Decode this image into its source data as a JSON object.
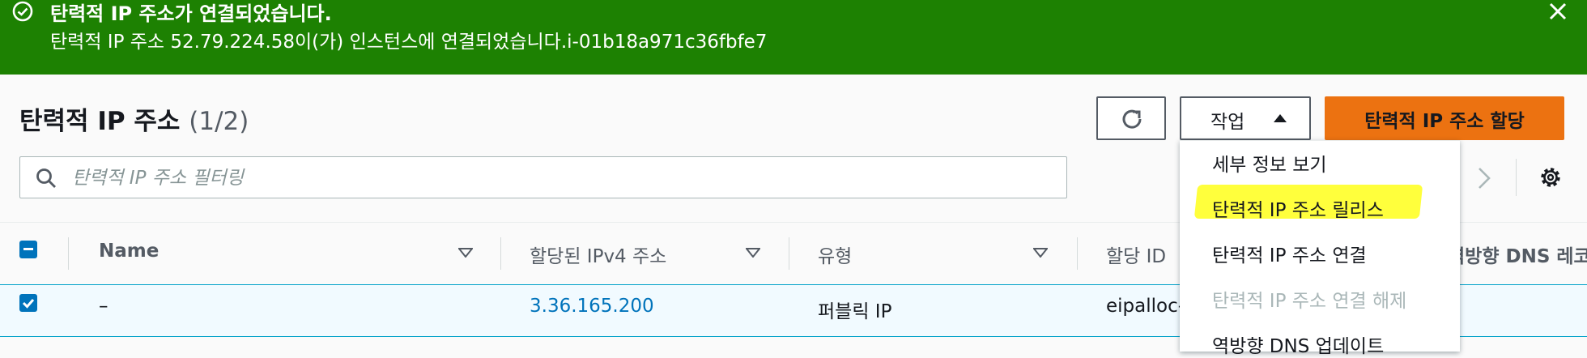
{
  "banner": {
    "title": "탄력적 IP 주소가 연결되었습니다.",
    "message": "탄력적 IP 주소 52.79.224.58이(가) 인스턴스에 연결되었습니다.i-01b18a971c36fbfe7",
    "color": "#1d8102"
  },
  "header": {
    "title": "탄력적 IP 주소",
    "count": "(1/2)",
    "actions_label": "작업",
    "allocate_label": "탄력적 IP 주소 할당"
  },
  "search": {
    "placeholder": "탄력적 IP 주소 필터링"
  },
  "table": {
    "columns": [
      "Name",
      "할당된 IPv4 주소",
      "유형",
      "할당 ID",
      "역방향 DNS 레코드"
    ],
    "rows": [
      {
        "name": "–",
        "ipv4": "3.36.165.200",
        "type": "퍼블릭 IP",
        "allocation_id": "eipalloc-",
        "selected": true
      }
    ]
  },
  "actions_menu": {
    "items": [
      {
        "label": "세부 정보 보기",
        "enabled": true
      },
      {
        "label": "탄력적 IP 주소 릴리스",
        "enabled": true,
        "highlighted": true
      },
      {
        "label": "탄력적 IP 주소 연결",
        "enabled": true
      },
      {
        "label": "탄력적 IP 주소 연결 해제",
        "enabled": false
      },
      {
        "label": "역방향 DNS 업데이트",
        "enabled": true
      }
    ]
  },
  "colors": {
    "primary": "#ec7211",
    "link": "#0073bb",
    "highlight": "#ffff3c"
  }
}
